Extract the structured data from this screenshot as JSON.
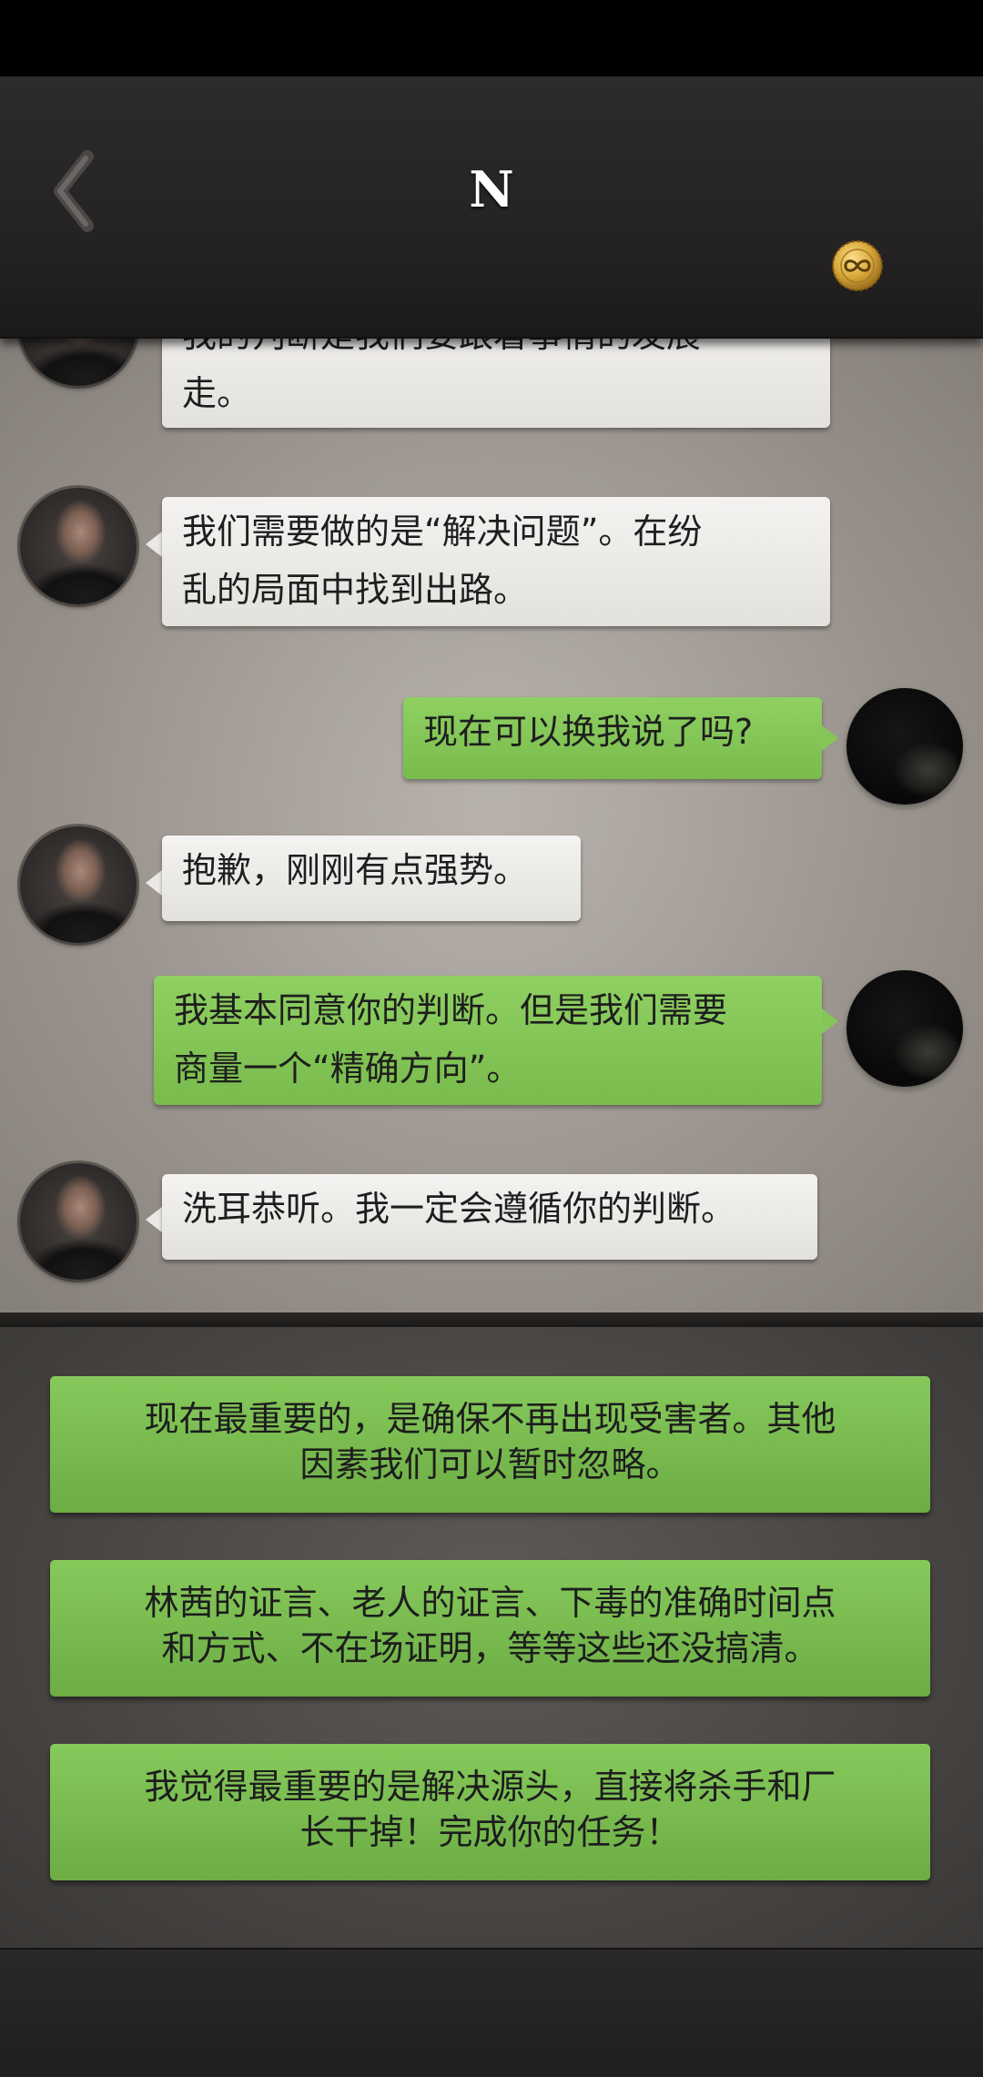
{
  "header": {
    "title": "N",
    "back_icon": "chevron-left-icon",
    "coin_icon": "infinity-coin-icon"
  },
  "chat": {
    "messages": [
      {
        "side": "left",
        "lines": [
          "我的判断是我们要跟着事情的发展",
          "走。"
        ]
      },
      {
        "side": "left",
        "lines": [
          "我们需要做的是“解决问题”。在纷",
          "乱的局面中找到出路。"
        ]
      },
      {
        "side": "right",
        "lines": [
          "现在可以换我说了吗?"
        ]
      },
      {
        "side": "left",
        "lines": [
          "抱歉，刚刚有点强势。"
        ]
      },
      {
        "side": "right",
        "lines": [
          "我基本同意你的判断。但是我们需要",
          "商量一个“精确方向”。"
        ]
      },
      {
        "side": "left",
        "lines": [
          "洗耳恭听。我一定会遵循你的判断。"
        ]
      }
    ]
  },
  "options": [
    {
      "lines": [
        "现在最重要的，是确保不再出现受害者。其他",
        "因素我们可以暂时忽略。"
      ]
    },
    {
      "lines": [
        "林茜的证言、老人的证言、下毒的准确时间点",
        "和方式、不在场证明，等等这些还没搞清。"
      ]
    },
    {
      "lines": [
        "我觉得最重要的是解决源头，直接将杀手和厂",
        "长干掉！完成你的任务！"
      ]
    }
  ],
  "colors": {
    "green_bubble": "#85c658",
    "white_bubble": "#ebe9e6",
    "header_bg": "#242222",
    "option_green": "#7abb4f"
  }
}
